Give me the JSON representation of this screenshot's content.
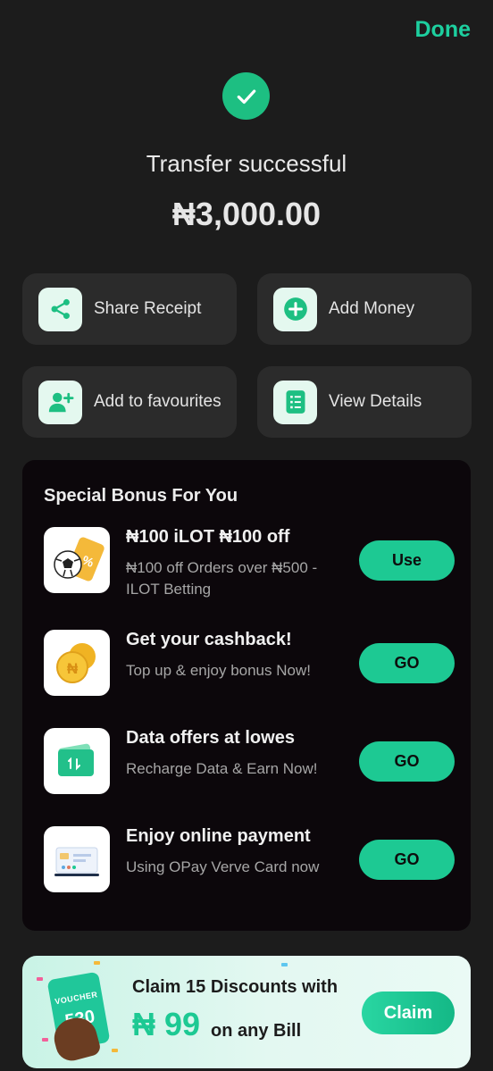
{
  "header": {
    "done_label": "Done"
  },
  "status": {
    "title": "Transfer successful",
    "amount": "₦3,000.00"
  },
  "actions": [
    {
      "label": "Share Receipt",
      "icon": "share-icon"
    },
    {
      "label": "Add Money",
      "icon": "plus-circle-icon"
    },
    {
      "label": "Add to favourites",
      "icon": "add-user-icon"
    },
    {
      "label": "View Details",
      "icon": "document-list-icon"
    }
  ],
  "bonus": {
    "title": "Special Bonus For You",
    "offers": [
      {
        "title": "₦100 iLOT ₦100 off",
        "subtitle": "₦100 off Orders over ₦500 - ILOT Betting",
        "button": "Use",
        "icon": "soccer-ticket-icon"
      },
      {
        "title": "Get your cashback!",
        "subtitle": "Top up & enjoy bonus Now!",
        "button": "GO",
        "icon": "coins-icon"
      },
      {
        "title": "Data offers at lowes",
        "subtitle": "Recharge Data & Earn Now!",
        "button": "GO",
        "icon": "data-card-icon"
      },
      {
        "title": "Enjoy online payment",
        "subtitle": "Using OPay Verve Card now",
        "button": "GO",
        "icon": "payment-card-icon"
      }
    ]
  },
  "banner": {
    "voucher_label": "VOUCHER",
    "voucher_number": "530",
    "line1": "Claim 15 Discounts with",
    "amount": "₦ 99",
    "suffix": "on any Bill",
    "button": "Claim"
  },
  "colors": {
    "accent": "#1dc993",
    "done_text": "#1dcf9f",
    "background": "#1c1c1c",
    "card": "#2b2b2b",
    "bonus_panel": "#0c070b"
  }
}
